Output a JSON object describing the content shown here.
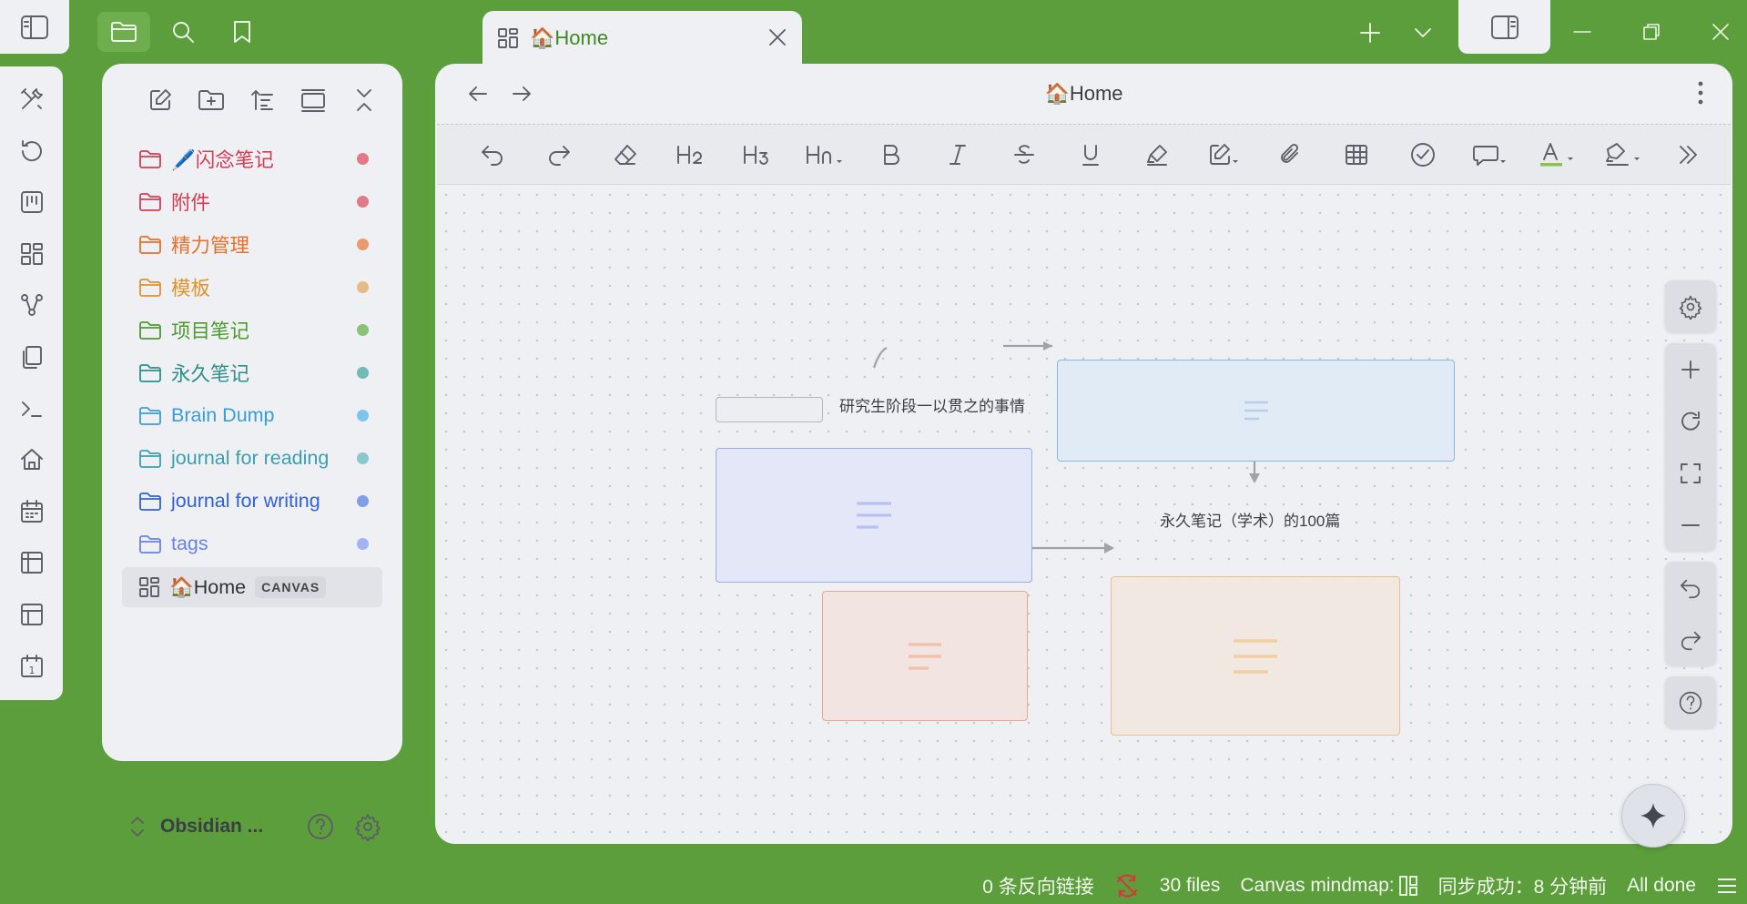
{
  "tab": {
    "title": "🏠Home"
  },
  "view": {
    "title": "🏠Home"
  },
  "explorer": {
    "items": [
      {
        "label": "🖊️闪念笔记",
        "color": "#d83b52",
        "dot": "#df7a86"
      },
      {
        "label": "附件",
        "color": "#d83b52",
        "dot": "#df7a86"
      },
      {
        "label": "精力管理",
        "color": "#e8702a",
        "dot": "#eb9a6f"
      },
      {
        "label": "模板",
        "color": "#e0932b",
        "dot": "#e6bb86"
      },
      {
        "label": "项目笔记",
        "color": "#4d9a2e",
        "dot": "#8ac276"
      },
      {
        "label": "永久笔记",
        "color": "#2e8f8a",
        "dot": "#73b9b6"
      },
      {
        "label": "Brain Dump",
        "color": "#3a9dd8",
        "dot": "#7fc2ea"
      },
      {
        "label": "journal for reading",
        "color": "#3aa0b0",
        "dot": "#8cc7cf"
      },
      {
        "label": "journal for writing",
        "color": "#2f62d8",
        "dot": "#7f9eea"
      },
      {
        "label": "tags",
        "color": "#6a82e6",
        "dot": "#a3b2f2"
      }
    ],
    "home": {
      "label": "🏠Home",
      "badge": "CANVAS"
    }
  },
  "vault": {
    "name": "Obsidian ..."
  },
  "canvas": {
    "edge_labels": {
      "top": "研究生阶段一以贯之的事情",
      "middle": "永久笔记（学术）的100篇"
    }
  },
  "status": {
    "backlinks": "0 条反向链接",
    "files": "30 files",
    "mindmap": "Canvas mindmap:",
    "sync": "同步成功：8 分钟前",
    "done": "All done"
  },
  "colors": {
    "accent": "#5c9d3c",
    "panel": "#eef0f4"
  }
}
